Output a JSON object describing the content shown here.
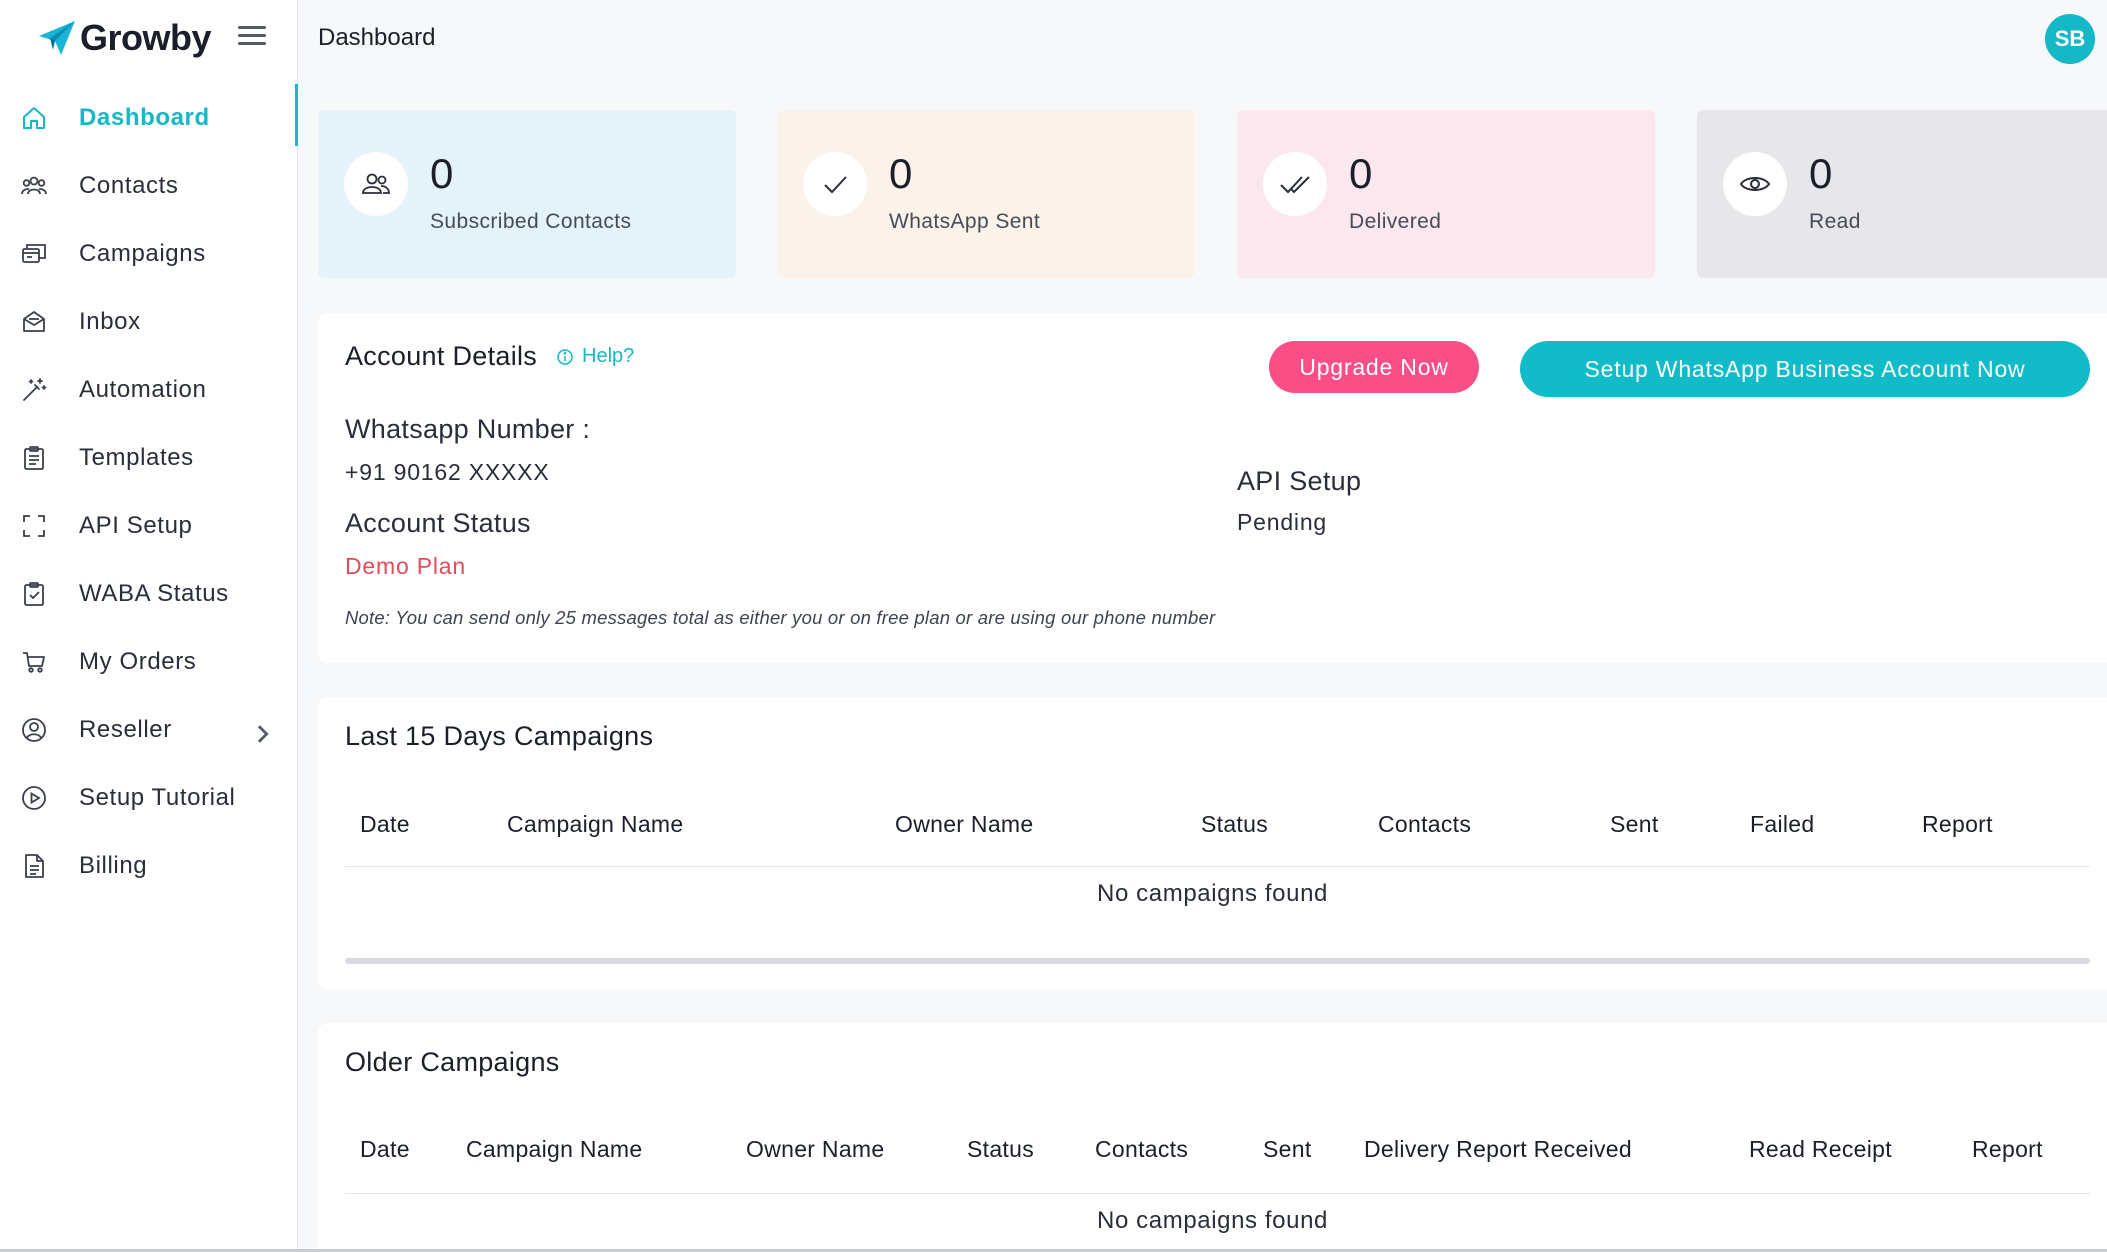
{
  "brand": {
    "name": "Growby"
  },
  "topbar": {
    "title": "Dashboard",
    "avatar_initials": "SB"
  },
  "colors": {
    "accent": "#14b8c6",
    "upgrade": "#fb4e87",
    "danger": "#e54b5b"
  },
  "sidebar": {
    "items": [
      {
        "label": "Dashboard",
        "icon": "home-icon",
        "active": true
      },
      {
        "label": "Contacts",
        "icon": "users-icon"
      },
      {
        "label": "Campaigns",
        "icon": "campaigns-icon"
      },
      {
        "label": "Inbox",
        "icon": "inbox-icon"
      },
      {
        "label": "Automation",
        "icon": "magic-wand-icon"
      },
      {
        "label": "Templates",
        "icon": "clipboard-icon"
      },
      {
        "label": "API Setup",
        "icon": "frame-icon"
      },
      {
        "label": "WABA Status",
        "icon": "clipboard-check-icon"
      },
      {
        "label": "My Orders",
        "icon": "cart-icon"
      },
      {
        "label": "Reseller",
        "icon": "user-circle-icon",
        "has_submenu": true
      },
      {
        "label": "Setup Tutorial",
        "icon": "play-circle-icon"
      },
      {
        "label": "Billing",
        "icon": "document-icon"
      }
    ]
  },
  "stats": [
    {
      "value": "0",
      "label": "Subscribed Contacts",
      "icon": "users-icon",
      "bg": "#e3f3f9"
    },
    {
      "value": "0",
      "label": "WhatsApp Sent",
      "icon": "check-icon",
      "bg": "#fbf3e9"
    },
    {
      "value": "0",
      "label": "Delivered",
      "icon": "double-check-icon",
      "bg": "#fbe8ef"
    },
    {
      "value": "0",
      "label": "Read",
      "icon": "eye-icon",
      "bg": "#e7e7ea"
    }
  ],
  "account": {
    "title": "Account Details",
    "help_label": "Help?",
    "upgrade_label": "Upgrade Now",
    "setup_label": "Setup WhatsApp Business Account Now",
    "whatsapp_label": "Whatsapp Number :",
    "whatsapp_value": "+91 90162 XXXXX",
    "status_label": "Account Status",
    "status_value": "Demo Plan",
    "api_label": "API Setup",
    "api_value": "Pending",
    "note": "Note: You can send only 25 messages total as either you or on free plan or are using our phone number"
  },
  "recent_campaigns": {
    "title": "Last 15 Days Campaigns",
    "columns": [
      "Date",
      "Campaign Name",
      "Owner Name",
      "Status",
      "Contacts",
      "Sent",
      "Failed",
      "Report"
    ],
    "empty": "No campaigns found"
  },
  "older_campaigns": {
    "title": "Older Campaigns",
    "columns": [
      "Date",
      "Campaign Name",
      "Owner Name",
      "Status",
      "Contacts",
      "Sent",
      "Delivery Report Received",
      "Read Receipt",
      "Report"
    ],
    "empty": "No campaigns found"
  }
}
